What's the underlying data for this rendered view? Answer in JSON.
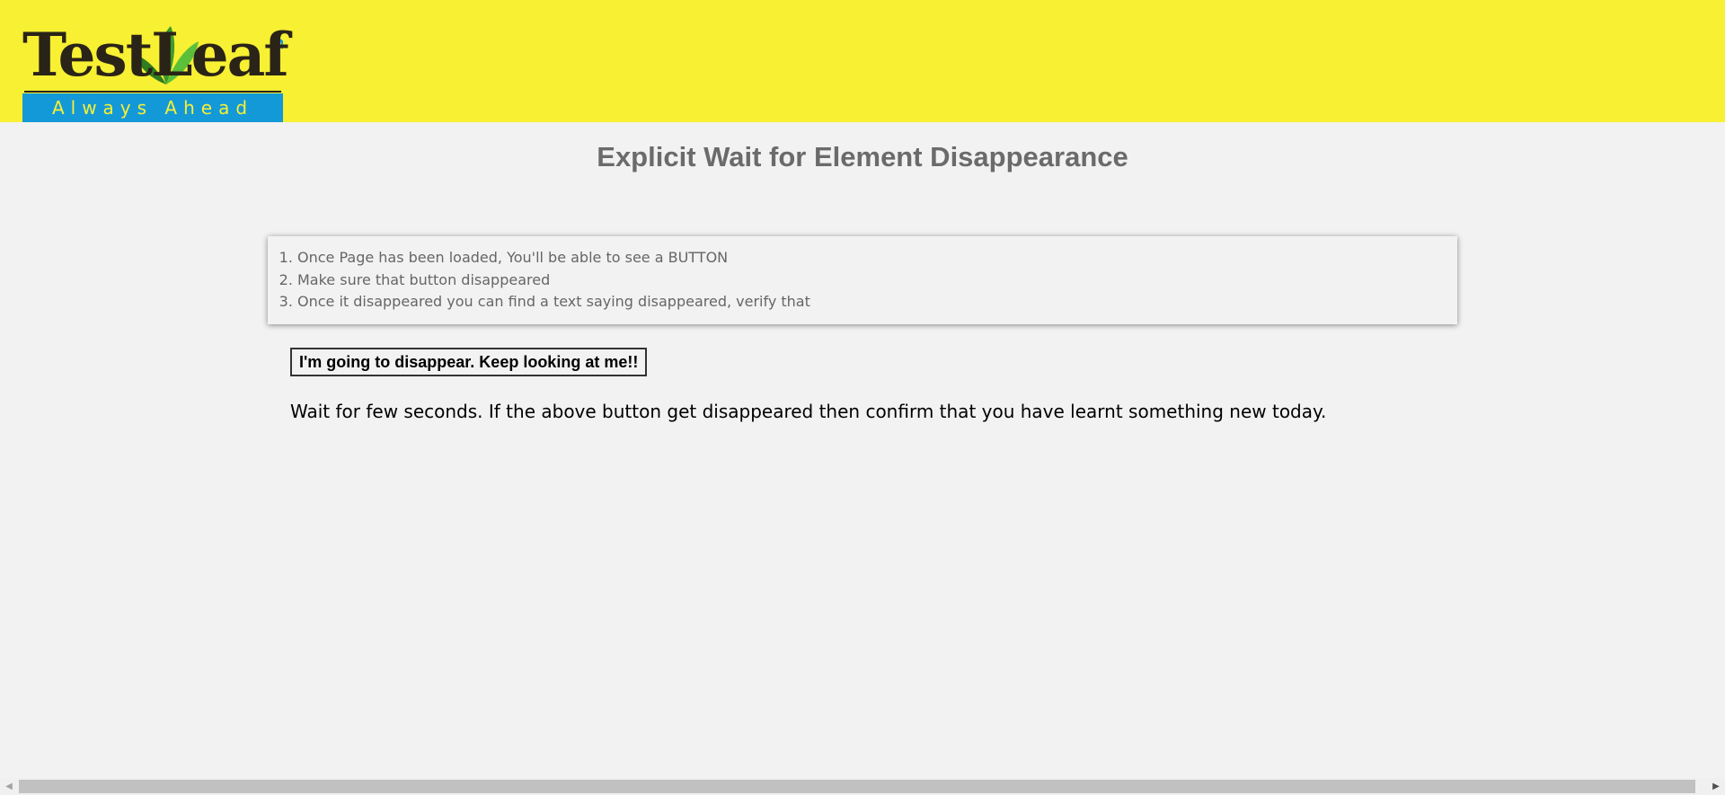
{
  "header": {
    "logo_word": "TestLeaf",
    "logo_tagline": "Always Ahead",
    "background_color": "#f7f033"
  },
  "main": {
    "title": "Explicit Wait for Element Disappearance",
    "instructions": [
      "Once Page has been loaded, You'll be able to see a BUTTON",
      "Make sure that button disappeared",
      "Once it disappeared you can find a text saying disappeared, verify that"
    ],
    "button_label": "I'm going to disappear. Keep looking at me!!",
    "message": "Wait for few seconds. If the above button get disappeared then confirm that you have learnt something new today."
  },
  "scrollbar": {
    "left_arrow_icon": "chevron-left-icon",
    "right_arrow_icon": "chevron-right-icon"
  }
}
